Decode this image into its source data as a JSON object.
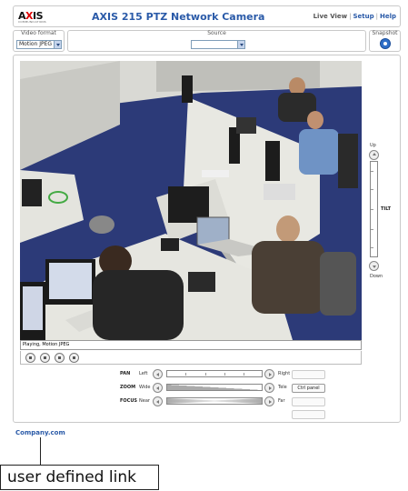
{
  "header": {
    "logo_text_a": "A",
    "logo_text_x": "X",
    "logo_text_b": "IS",
    "logo_sub": "COMMUNICATIONS",
    "title": "AXIS 215 PTZ Network Camera",
    "nav": [
      {
        "label": "Live View"
      },
      {
        "label": "Setup"
      },
      {
        "label": "Help"
      }
    ],
    "separator": "|"
  },
  "toolbar": {
    "video_format_label": "Video format",
    "video_format_value": "Motion JPEG",
    "source_label": "Source",
    "source_value": "",
    "snapshot_label": "Snapshot"
  },
  "video": {
    "status_text": "Playing, Motion JPEG"
  },
  "tilt": {
    "up_label": "Up",
    "down_label": "Down",
    "name": "TILT"
  },
  "ptz": {
    "pan": {
      "name": "PAN",
      "left": "Left",
      "right": "Right"
    },
    "zoom": {
      "name": "ZOOM",
      "left": "Wide",
      "right": "Tele"
    },
    "focus": {
      "name": "FOCUS",
      "left": "Near",
      "right": "Far"
    },
    "ctrl_panel_label": "Ctrl panel"
  },
  "footer": {
    "company_link": "Company.com",
    "callout": "user defined link"
  },
  "colors": {
    "link_blue": "#2a5aa8",
    "carpet_blue": "#2c3a78",
    "desk_white": "#e8e8e2"
  }
}
